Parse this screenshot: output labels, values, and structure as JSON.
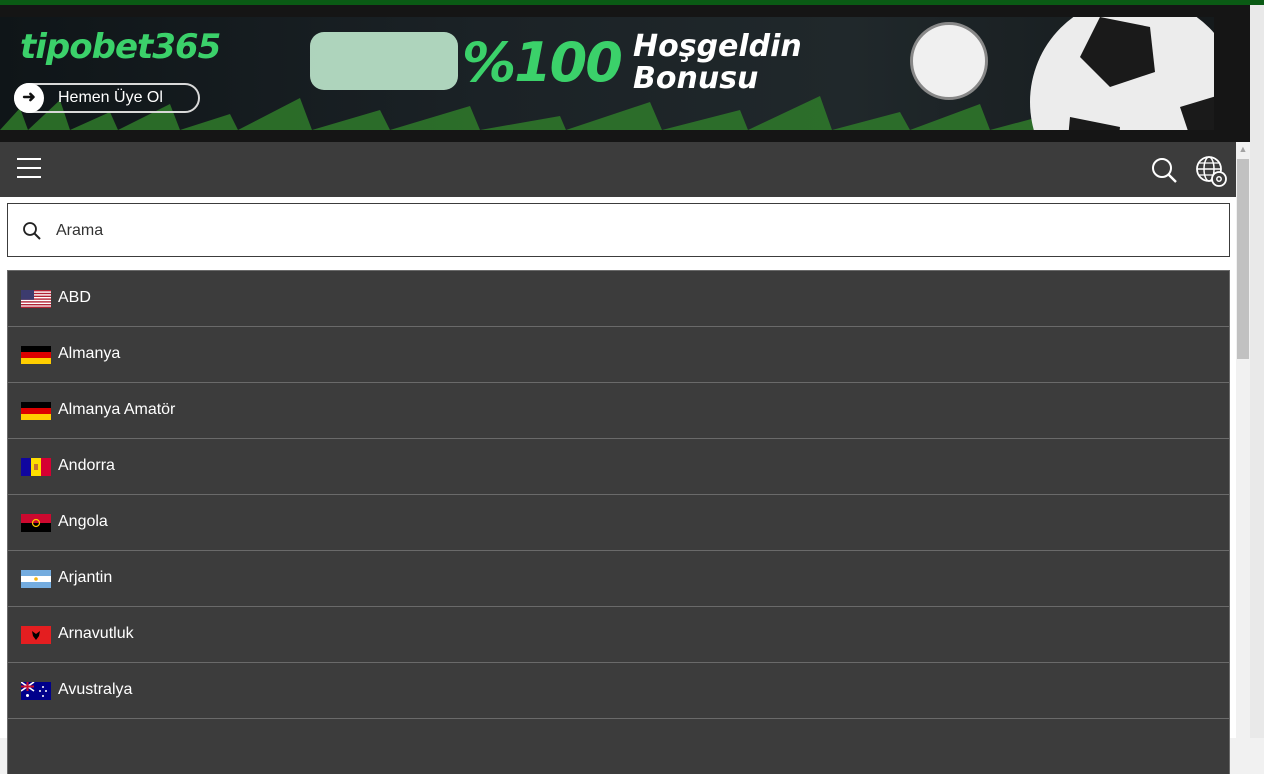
{
  "banner": {
    "logo_text": "tipobet365",
    "join_label": "Hemen Üye Ol",
    "bonus_percent": "%100",
    "bonus_line1": "Hoşgeldin",
    "bonus_line2": "Bonusu"
  },
  "header": {
    "menu_icon": "hamburger-menu-icon",
    "search_icon": "search-icon",
    "settings_icon": "globe-gear-icon"
  },
  "search": {
    "placeholder": "Arama",
    "value": ""
  },
  "countries": [
    {
      "label": "ABD",
      "flag": "us-flag-icon"
    },
    {
      "label": "Almanya",
      "flag": "germany-flag-icon"
    },
    {
      "label": "Almanya Amatör",
      "flag": "germany-flag-icon"
    },
    {
      "label": "Andorra",
      "flag": "andorra-flag-icon"
    },
    {
      "label": "Angola",
      "flag": "angola-flag-icon"
    },
    {
      "label": "Arjantin",
      "flag": "argentina-flag-icon"
    },
    {
      "label": "Arnavutluk",
      "flag": "albania-flag-icon"
    },
    {
      "label": "Avustralya",
      "flag": "australia-flag-icon"
    }
  ],
  "colors": {
    "brand_green": "#3bd16a",
    "header_bg": "#3c3c3c",
    "list_bg": "#3c3c3c"
  }
}
